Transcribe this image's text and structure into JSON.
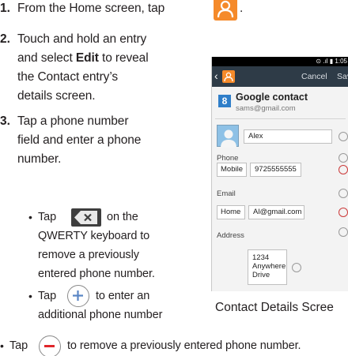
{
  "steps": [
    {
      "number": "1.",
      "text": "From the Home screen, tap",
      "suffix": "."
    },
    {
      "number": "2.",
      "line1": "Touch and hold an entry",
      "line2_pre": "and select",
      "line2_bold": "Edit",
      "line2_post": "to reveal",
      "line3": "the Contact entry’s",
      "line4": "details screen."
    },
    {
      "number": "3.",
      "line1": "Tap a phone number",
      "line2": "field and enter a phone",
      "line3": "number."
    }
  ],
  "bullets": [
    {
      "pre": "Tap",
      "post": "on the",
      "line2": "QWERTY keyboard to",
      "line3": "remove a previously",
      "line4": "entered phone number."
    },
    {
      "pre": "Tap",
      "post": "to enter an",
      "line2": "additional phone number"
    },
    {
      "pre": "Tap",
      "post": "to remove a previously entered phone number."
    }
  ],
  "caption": "Contact Details Scree",
  "phone": {
    "status": "⊙ .ıl ▮ 1:05",
    "back": "‹",
    "cancel": "Cancel",
    "save": "Sav",
    "account_logo": "8",
    "account_title": "Google contact",
    "account_email": "sams@gmail.com",
    "name_value": "Alex",
    "phone_label": "Phone",
    "phone_type": "Mobile",
    "phone_value": "9725555555",
    "email_label": "Email",
    "email_type": "Home",
    "email_value": "Al@gmail.com",
    "address_label": "Address",
    "address_lines": [
      "1234",
      "Anywhere",
      "Drive"
    ]
  },
  "icons": {
    "contacts_app": "contacts-app-icon",
    "delete_key": "delete-key-icon",
    "add": "add-circle-icon",
    "remove": "remove-circle-icon"
  },
  "colors": {
    "accent_orange": "#f58a2a",
    "remove_red": "#e0262a",
    "action_bar": "#2e3b47"
  }
}
